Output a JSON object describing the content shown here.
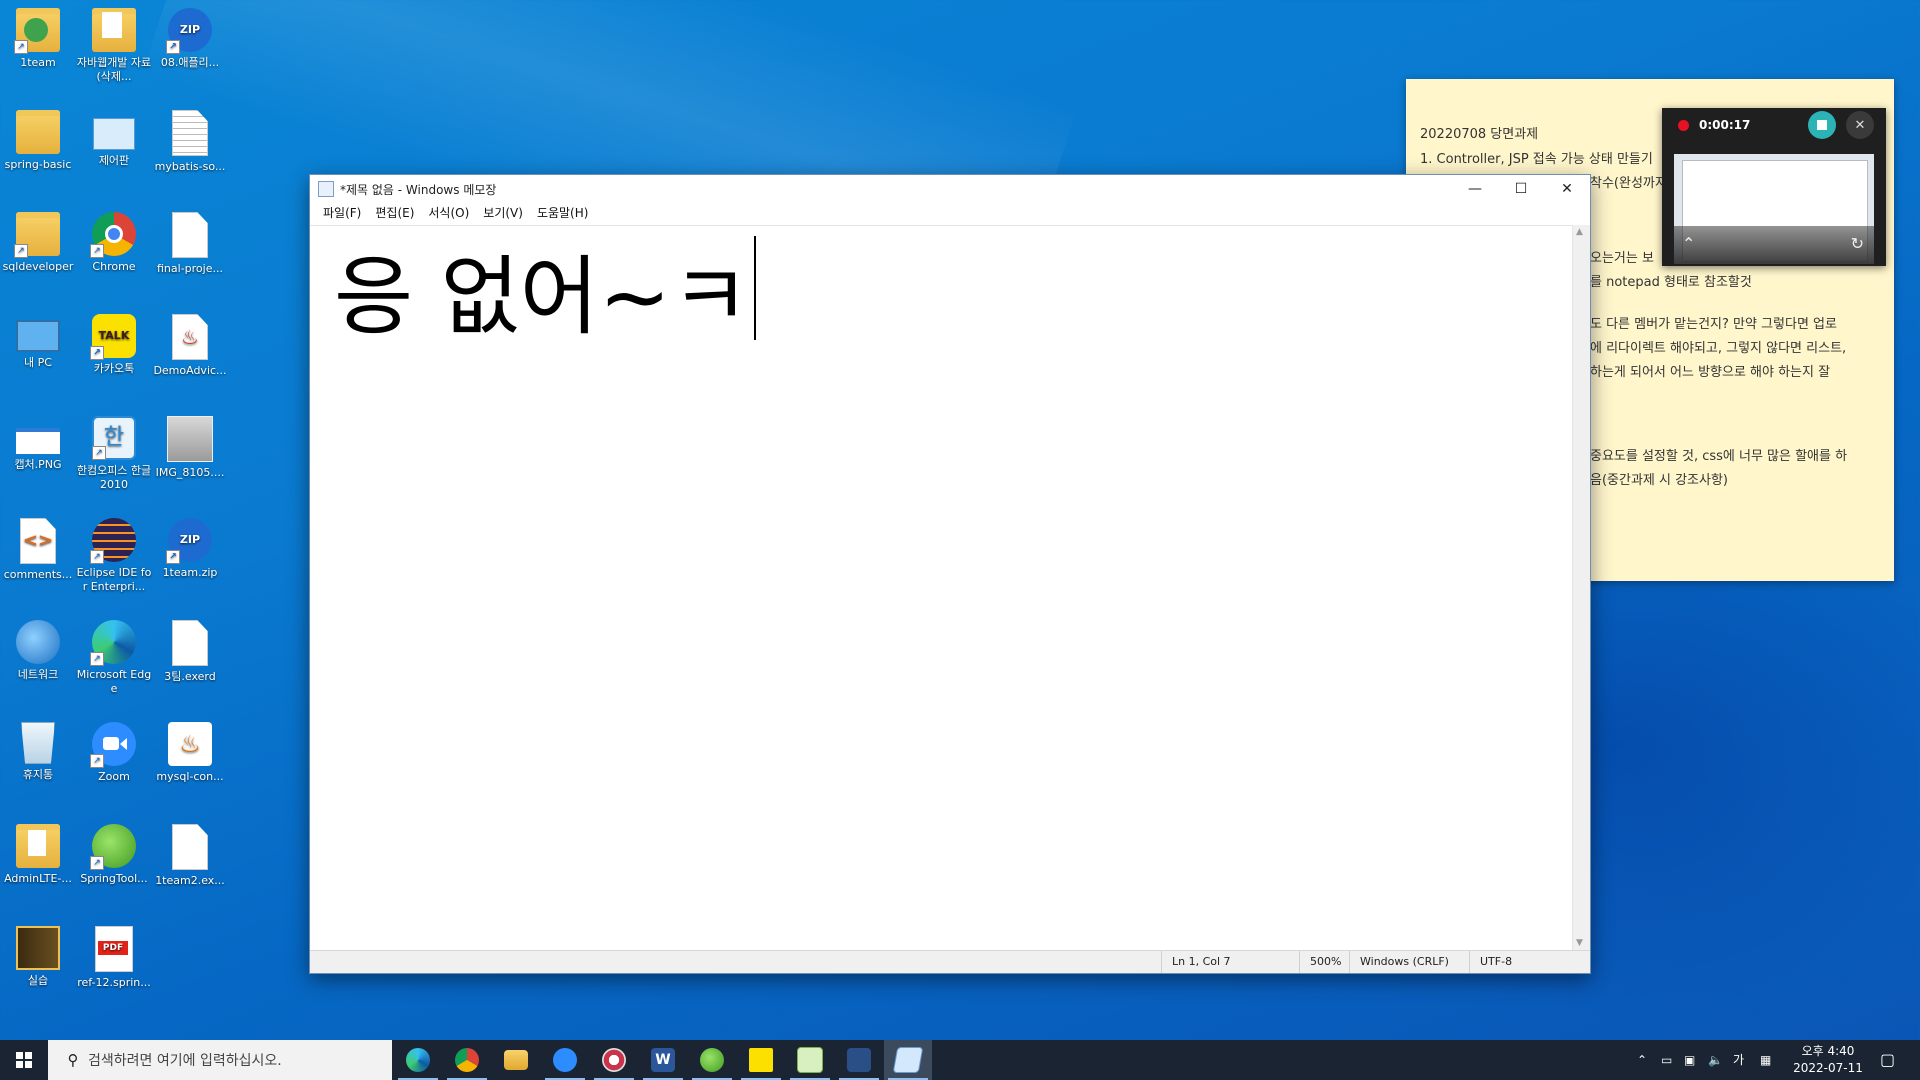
{
  "desktop": {
    "icons": [
      {
        "label": "1team",
        "kind": "folder-green"
      },
      {
        "label": "자바웹개발 자료(삭제...",
        "kind": "folder-doc"
      },
      {
        "label": "08.애플리...",
        "kind": "zip"
      },
      {
        "label": "spring-basic",
        "kind": "folder"
      },
      {
        "label": "제어판",
        "kind": "control-panel"
      },
      {
        "label": "mybatis-so...",
        "kind": "text-file"
      },
      {
        "label": "sqldeveloper",
        "kind": "folder-app"
      },
      {
        "label": "Chrome",
        "kind": "chrome"
      },
      {
        "label": "final-proje...",
        "kind": "file"
      },
      {
        "label": "내 PC",
        "kind": "pc"
      },
      {
        "label": "카카오톡",
        "kind": "kakaotalk"
      },
      {
        "label": "DemoAdvic...",
        "kind": "java-file"
      },
      {
        "label": "캡처.PNG",
        "kind": "image"
      },
      {
        "label": "한컴오피스 한글 2010",
        "kind": "hancom"
      },
      {
        "label": "IMG_8105....",
        "kind": "photo"
      },
      {
        "label": "comments...",
        "kind": "code-file"
      },
      {
        "label": "Eclipse IDE for Enterpri...",
        "kind": "eclipse"
      },
      {
        "label": "1team.zip",
        "kind": "zip"
      },
      {
        "label": "네트워크",
        "kind": "network"
      },
      {
        "label": "Microsoft Edge",
        "kind": "edge"
      },
      {
        "label": "3팀.exerd",
        "kind": "file"
      },
      {
        "label": "휴지통",
        "kind": "recycle-bin"
      },
      {
        "label": "Zoom",
        "kind": "zoom"
      },
      {
        "label": "mysql-con...",
        "kind": "java-jar"
      },
      {
        "label": "AdminLTE-...",
        "kind": "folder"
      },
      {
        "label": "SpringTool...",
        "kind": "spring"
      },
      {
        "label": "1team2.ex...",
        "kind": "file"
      },
      {
        "label": "실습",
        "kind": "folder-dark"
      },
      {
        "label": "ref-12.sprin...",
        "kind": "pdf"
      }
    ]
  },
  "sticky_note": {
    "lines": [
      "20220708 당면과제",
      "1. Controller, JSP 접속 가능 상태 만들기",
      "착수(완성까지",
      "오는거는 보",
      "를 notepad 형태로 참조할것",
      "도 다른 멤버가 맡는건지? 만약 그렇다면 업로",
      "에 리다이렉트 해야되고, 그렇지 않다면 리스트,",
      "하는게 되어서 어느 방향으로 해야 하는지 잘",
      "중요도를 설정할 것, css에 너무 많은 할애를 하",
      "음(중간과제 시 강조사항)"
    ]
  },
  "recorder": {
    "elapsed": "0:00:17",
    "record_color": "#e81123",
    "stop_color": "#2bb3b6"
  },
  "notepad": {
    "title": "*제목 없음 - Windows 메모장",
    "menu": [
      "파일(F)",
      "편집(E)",
      "서식(O)",
      "보기(V)",
      "도움말(H)"
    ],
    "content": "응 없어~ㅋ",
    "status": {
      "position": "Ln 1, Col 7",
      "zoom": "500%",
      "line_ending": "Windows (CRLF)",
      "encoding": "UTF-8"
    }
  },
  "taskbar": {
    "search_placeholder": "검색하려면 여기에 입력하십시오.",
    "apps": [
      "edge",
      "chrome",
      "file-explorer",
      "zoom",
      "snipping-tool",
      "word",
      "spring-tool-suite",
      "sticky-notes",
      "notepad-plus",
      "sql-developer",
      "notepad"
    ],
    "ime": "가",
    "clock_time": "오후 4:40",
    "clock_date": "2022-07-11"
  }
}
